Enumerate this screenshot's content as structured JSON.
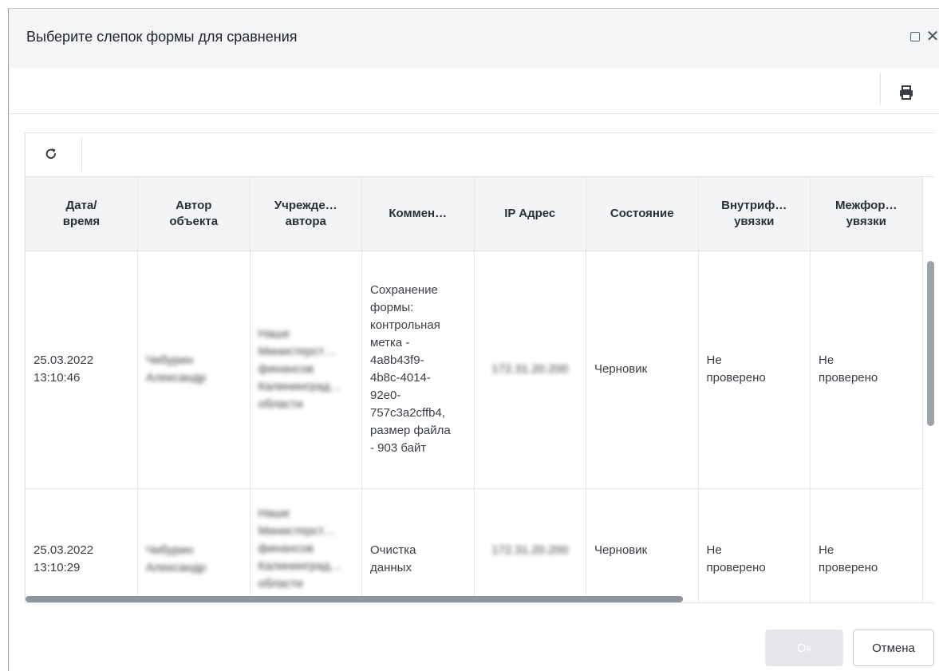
{
  "dialog": {
    "title": "Выберите слепок формы для сравнения",
    "icons": {
      "maximize": "maximize-icon",
      "close": "close-icon",
      "print": "print-icon",
      "refresh": "refresh-icon"
    },
    "close_glyph": "✕"
  },
  "table": {
    "columns": [
      {
        "line1": "Дата/",
        "line2": "время"
      },
      {
        "line1": "Автор",
        "line2": "объекта"
      },
      {
        "line1": "Учрежде…",
        "line2": "автора"
      },
      {
        "line1": "Коммен…",
        "line2": ""
      },
      {
        "line1": "IP Адрес",
        "line2": ""
      },
      {
        "line1": "Состояние",
        "line2": ""
      },
      {
        "line1": "Внутриф…",
        "line2": "увязки"
      },
      {
        "line1": "Межфор…",
        "line2": "увязки"
      }
    ],
    "rows": [
      {
        "date": "25.03.2022",
        "time": "13:10:46",
        "author_l1": "Чибурин",
        "author_l2": "Александр",
        "org_l1": "Наше",
        "org_l2": "Министерст…",
        "org_l3": "финансов",
        "org_l4": "Калининград…",
        "org_l5": "области",
        "comment": [
          "Сохранение",
          "формы:",
          "контрольная",
          "метка -",
          "4a8b43f9-",
          "4b8c-4014-",
          "92e0-",
          "757c3a2cffb4,",
          "размер файла",
          "- 903 байт"
        ],
        "ip": "172.31.20.200",
        "state": "Черновик",
        "intra_l1": "Не",
        "intra_l2": "проверено",
        "inter_l1": "Не",
        "inter_l2": "проверено"
      },
      {
        "date": "25.03.2022",
        "time": "13:10:29",
        "author_l1": "Чибурин",
        "author_l2": "Александр",
        "org_l1": "Наше",
        "org_l2": "Министерст…",
        "org_l3": "финансов",
        "org_l4": "Калининград…",
        "org_l5": "области",
        "comment": [
          "Очистка",
          "данных"
        ],
        "ip": "172.31.20.200",
        "state": "Черновик",
        "intra_l1": "Не",
        "intra_l2": "проверено",
        "inter_l1": "Не",
        "inter_l2": "проверено"
      }
    ]
  },
  "buttons": {
    "ok": "Ок",
    "cancel": "Отмена"
  }
}
